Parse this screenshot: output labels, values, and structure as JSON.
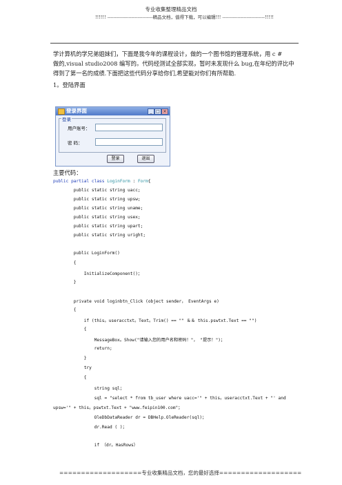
{
  "header": {
    "title": "专业收集整理精品文档",
    "banner": "!!!!!! ------------------------------精品文档，值得下载，可以编辑!!! ----------------------------!!!!!"
  },
  "intro": {
    "line1": "学计算机的学兄弟姐妹们，下面是我今年的课程设计，做的一个图书馆的管理系统，用 c #",
    "line2": "做的,visual studio2008 编写的。代码经测试全部实现，暂时未发现什么 bug,在年纪的评比中",
    "line3": "得到了第一名的成绩.下面把这些代码分享给你们,希望能对你们有所帮助."
  },
  "section1": "1。登陆界面",
  "login_window": {
    "title": "登录界面",
    "group_label": "登录",
    "user_label": "用户账号：",
    "pwd_label": "密      码：",
    "login_button": "登录",
    "exit_button": "退出",
    "min_glyph": "_",
    "max_glyph": "□",
    "close_glyph": "×"
  },
  "code_heading": "主要代码：",
  "code": {
    "l1a": "public partial class ",
    "l1b": "LoginForm",
    "l1c": " : ",
    "l1d": "Form",
    "l1e": "{",
    "f1": "        public static string uacc;",
    "f2": "        public static string upsw;",
    "f3": "        public static string uname;",
    "f4": "        public static string usex;",
    "f5": "        public static string upart;",
    "f6": "        public static string uright;",
    "c1": "        public LoginForm()",
    "c2": "        {",
    "c3": "            InitializeComponent()；",
    "c4": "        }",
    "m1": "        private void loginbtn_Click (object sender， EventArgs e)",
    "m2": "        {",
    "m3": "            if (this。useracctxt。Text。Trim() == \"\" ＆＆ this.pswtxt.Text == \"\")",
    "m4": "            {",
    "m5": "                MessageBox。Show(\"请输入您的用户名和密码！\"， \"提示！\")；",
    "m6": "                return;",
    "m7": "            }",
    "m8": "            try",
    "m9": "            {",
    "m10": "                string sql；",
    "m11": "                sql = \"select * from tb_user where uacc='\" + this。useracctxt.Text + \"' and",
    "m12": "upsw='\" + this。pswtxt.Text + \"www.feipin100.com\"；",
    "m13": "                OleDbDataReader dr = DBHelp.OleReader(sql)；",
    "m14": "                dr.Read ( )；",
    "m15": "                if （dr。HasRows）"
  },
  "footer": "===================专业收集精品文档，您的最好选择==================="
}
